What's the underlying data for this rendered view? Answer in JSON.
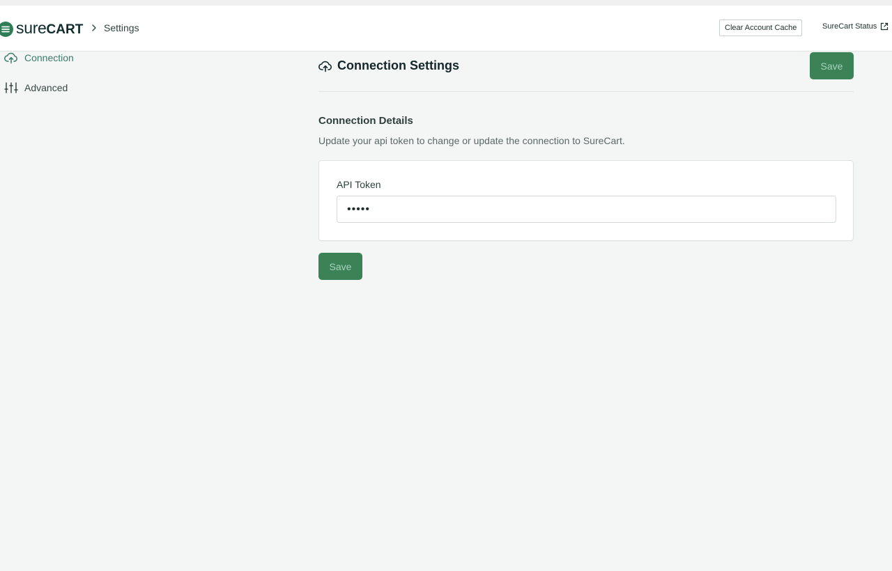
{
  "app": {
    "brand_prefix": "sure",
    "brand_suffix": "CART",
    "accent_color": "#3b8257"
  },
  "header": {
    "breadcrumb_page": "Settings",
    "clear_cache_label": "Clear Account Cache",
    "status_link_label": "SureCart Status"
  },
  "sidebar": {
    "items": [
      {
        "label": "Connection",
        "icon": "cloud-upload-icon",
        "active": true
      },
      {
        "label": "Advanced",
        "icon": "sliders-icon",
        "active": false
      }
    ]
  },
  "main": {
    "title": "Connection Settings",
    "save_label": "Save",
    "section_title": "Connection Details",
    "section_description": "Update your api token to change or update the connection to SureCart.",
    "api_token_label": "API Token",
    "api_token_value": "•••••",
    "save_bottom_label": "Save"
  }
}
